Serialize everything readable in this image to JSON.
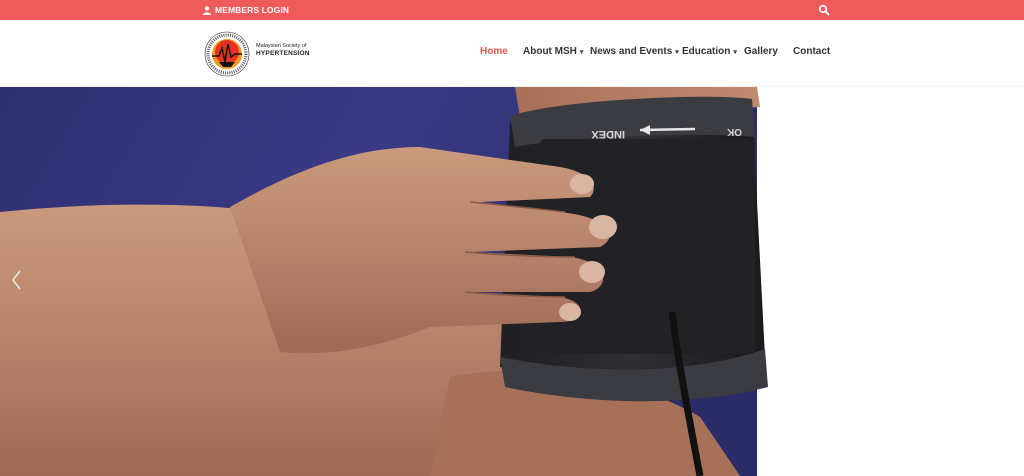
{
  "topbar": {
    "members_login": "MEMBERS LOGIN",
    "user_icon": "user-icon",
    "search_icon": "search-icon",
    "color": "#ef5a5a"
  },
  "logo": {
    "line1": "Malaysian Society of",
    "line2": "HYPERTENSION"
  },
  "nav": {
    "items": [
      {
        "label": "Home",
        "active": true
      },
      {
        "label": "About MSH",
        "dropdown": true
      },
      {
        "label": "News and Events",
        "dropdown": true
      },
      {
        "label": "Education",
        "dropdown": true
      },
      {
        "label": "Gallery"
      },
      {
        "label": "Contact"
      }
    ],
    "caret": "▾",
    "active_color": "#e9534f"
  },
  "hero": {
    "cuff_text_1": "INDEX",
    "cuff_text_2": "OK",
    "prev_icon": "chevron-left-icon"
  }
}
